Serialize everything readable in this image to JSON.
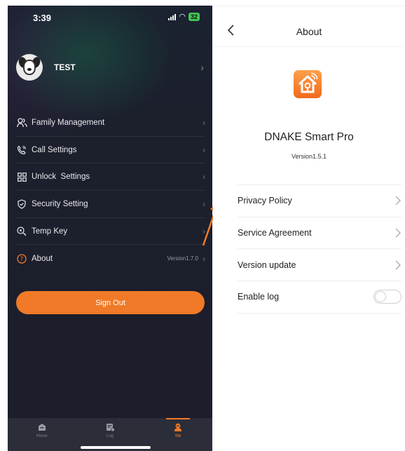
{
  "left_screen": {
    "status_bar": {
      "time": "3:39",
      "battery": "32"
    },
    "profile": {
      "name": "TEST"
    },
    "menu": [
      {
        "label": "Family Management",
        "icon": "family-icon"
      },
      {
        "label": "Call Settings",
        "icon": "phone-icon"
      },
      {
        "label": "Unlock  Settings",
        "icon": "grid-icon"
      },
      {
        "label": "Security Setting",
        "icon": "shield-icon"
      },
      {
        "label": "Temp Key",
        "icon": "key-icon"
      },
      {
        "label": "About",
        "icon": "help-icon",
        "extra": "Version1.7.0"
      }
    ],
    "sign_out_label": "Sign Out",
    "tabs": [
      {
        "label": "Home",
        "icon": "home-icon",
        "active": false
      },
      {
        "label": "Log",
        "icon": "log-icon",
        "active": false
      },
      {
        "label": "Me",
        "icon": "user-icon",
        "active": true
      }
    ]
  },
  "right_screen": {
    "title": "About",
    "app_name": "DNAKE Smart Pro",
    "version": "Version1.5.1",
    "items": [
      {
        "label": "Privacy Policy",
        "type": "link"
      },
      {
        "label": "Service Agreement",
        "type": "link"
      },
      {
        "label": "Version update",
        "type": "link"
      },
      {
        "label": "Enable log",
        "type": "toggle",
        "enabled": false
      }
    ]
  },
  "colors": {
    "accent": "#F07A27",
    "dark_bg": "#1D1E2B",
    "tab_bar": "#2B2D39"
  }
}
